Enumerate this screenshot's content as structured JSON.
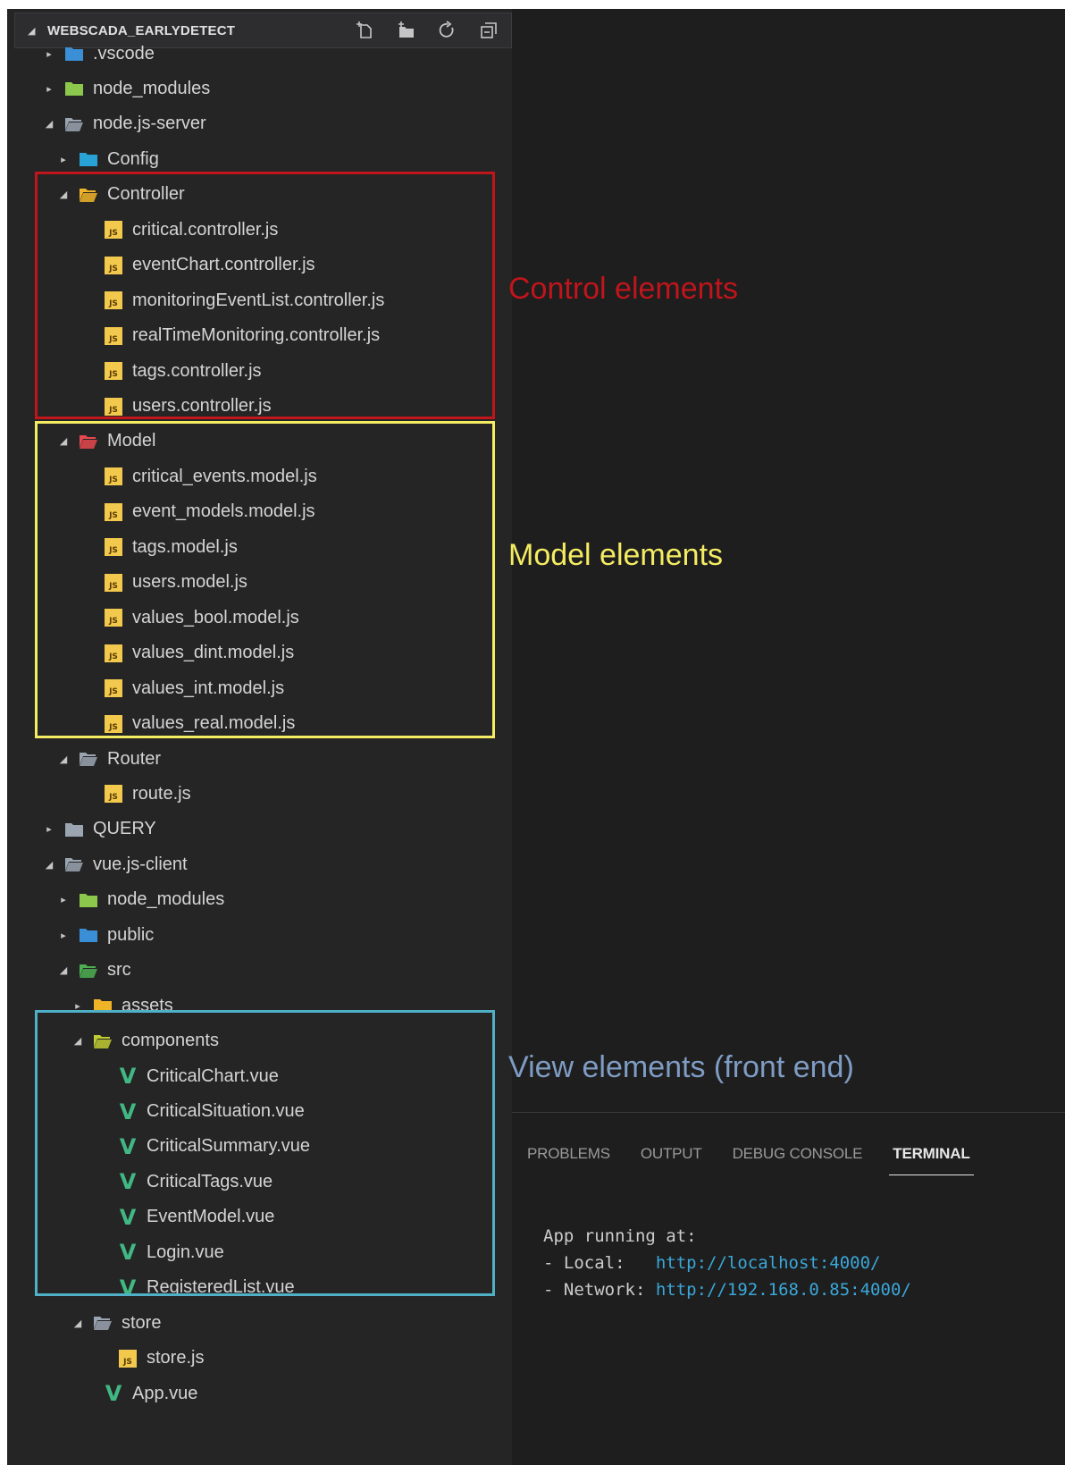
{
  "explorer": {
    "title": "WEBSCADA_EARLYDETECT",
    "actions": [
      {
        "name": "new-file-button",
        "icon": "new-file-icon"
      },
      {
        "name": "new-folder-button",
        "icon": "new-folder-icon"
      },
      {
        "name": "refresh-button",
        "icon": "refresh-icon"
      },
      {
        "name": "collapse-all-button",
        "icon": "collapse-all-icon"
      }
    ],
    "tree": [
      {
        "label": ".vscode",
        "depth": 0,
        "type": "folder",
        "expanded": false,
        "icon": "vscode-folder-icon",
        "color": "#3b8fd6"
      },
      {
        "label": "node_modules",
        "depth": 0,
        "type": "folder",
        "expanded": false,
        "icon": "node-folder-icon",
        "color": "#8cc84b"
      },
      {
        "label": "node.js-server",
        "depth": 0,
        "type": "folder",
        "expanded": true,
        "icon": "folder-open-icon",
        "color": "#9aa5b1"
      },
      {
        "label": "Config",
        "depth": 1,
        "type": "folder",
        "expanded": false,
        "icon": "config-folder-icon",
        "color": "#29a3d6"
      },
      {
        "label": "Controller",
        "depth": 1,
        "type": "folder",
        "expanded": true,
        "icon": "controller-folder-icon",
        "color": "#f0b429"
      },
      {
        "label": "critical.controller.js",
        "depth": 2,
        "type": "js"
      },
      {
        "label": "eventChart.controller.js",
        "depth": 2,
        "type": "js"
      },
      {
        "label": "monitoringEventList.controller.js",
        "depth": 2,
        "type": "js"
      },
      {
        "label": "realTimeMonitoring.controller.js",
        "depth": 2,
        "type": "js"
      },
      {
        "label": "tags.controller.js",
        "depth": 2,
        "type": "js"
      },
      {
        "label": "users.controller.js",
        "depth": 2,
        "type": "js"
      },
      {
        "label": "Model",
        "depth": 1,
        "type": "folder",
        "expanded": true,
        "icon": "model-folder-icon",
        "color": "#e5484d"
      },
      {
        "label": "critical_events.model.js",
        "depth": 2,
        "type": "js"
      },
      {
        "label": "event_models.model.js",
        "depth": 2,
        "type": "js"
      },
      {
        "label": "tags.model.js",
        "depth": 2,
        "type": "js"
      },
      {
        "label": "users.model.js",
        "depth": 2,
        "type": "js"
      },
      {
        "label": "values_bool.model.js",
        "depth": 2,
        "type": "js"
      },
      {
        "label": "values_dint.model.js",
        "depth": 2,
        "type": "js"
      },
      {
        "label": "values_int.model.js",
        "depth": 2,
        "type": "js"
      },
      {
        "label": "values_real.model.js",
        "depth": 2,
        "type": "js"
      },
      {
        "label": "Router",
        "depth": 1,
        "type": "folder",
        "expanded": true,
        "icon": "folder-open-icon",
        "color": "#9aa5b1"
      },
      {
        "label": "route.js",
        "depth": 2,
        "type": "js"
      },
      {
        "label": "QUERY",
        "depth": 0,
        "type": "folder",
        "expanded": false,
        "icon": "folder-icon",
        "color": "#9aa5b1"
      },
      {
        "label": "vue.js-client",
        "depth": 0,
        "type": "folder",
        "expanded": true,
        "icon": "folder-open-icon",
        "color": "#9aa5b1"
      },
      {
        "label": "node_modules",
        "depth": 1,
        "type": "folder",
        "expanded": false,
        "icon": "node-folder-icon",
        "color": "#8cc84b"
      },
      {
        "label": "public",
        "depth": 1,
        "type": "folder",
        "expanded": false,
        "icon": "public-folder-icon",
        "color": "#3b8fd6"
      },
      {
        "label": "src",
        "depth": 1,
        "type": "folder",
        "expanded": true,
        "icon": "src-folder-icon",
        "color": "#4caf50"
      },
      {
        "label": "assets",
        "depth": 2,
        "type": "folder",
        "expanded": false,
        "icon": "assets-folder-icon",
        "color": "#f0b429"
      },
      {
        "label": "components",
        "depth": 2,
        "type": "folder",
        "expanded": true,
        "icon": "components-folder-icon",
        "color": "#c0ca33"
      },
      {
        "label": "CriticalChart.vue",
        "depth": 3,
        "type": "vue"
      },
      {
        "label": "CriticalSituation.vue",
        "depth": 3,
        "type": "vue"
      },
      {
        "label": "CriticalSummary.vue",
        "depth": 3,
        "type": "vue"
      },
      {
        "label": "CriticalTags.vue",
        "depth": 3,
        "type": "vue"
      },
      {
        "label": "EventModel.vue",
        "depth": 3,
        "type": "vue"
      },
      {
        "label": "Login.vue",
        "depth": 3,
        "type": "vue"
      },
      {
        "label": "RegisteredList.vue",
        "depth": 3,
        "type": "vue"
      },
      {
        "label": "store",
        "depth": 2,
        "type": "folder",
        "expanded": true,
        "icon": "folder-open-icon",
        "color": "#9aa5b1"
      },
      {
        "label": "store.js",
        "depth": 3,
        "type": "js"
      },
      {
        "label": "App.vue",
        "depth": 2,
        "type": "vue"
      }
    ]
  },
  "annotations": {
    "control": {
      "text": "Control elements",
      "color": "#c0151b"
    },
    "model": {
      "text": "Model elements",
      "color": "#f4ec62"
    },
    "view": {
      "text": "View elements (front end)",
      "color": "#7f9cc4"
    }
  },
  "box_colors": {
    "control": "#c0151b",
    "model": "#f4ec62",
    "view": "#4fb0c6"
  },
  "panel": {
    "tabs": [
      {
        "label": "PROBLEMS",
        "active": false
      },
      {
        "label": "OUTPUT",
        "active": false
      },
      {
        "label": "DEBUG CONSOLE",
        "active": false
      },
      {
        "label": "TERMINAL",
        "active": true
      }
    ],
    "terminal": {
      "line1": "App running at:",
      "local_label": "- Local:   ",
      "local_url": "http://localhost:4000/",
      "network_label": "- Network: ",
      "network_url": "http://192.168.0.85:4000/"
    }
  }
}
